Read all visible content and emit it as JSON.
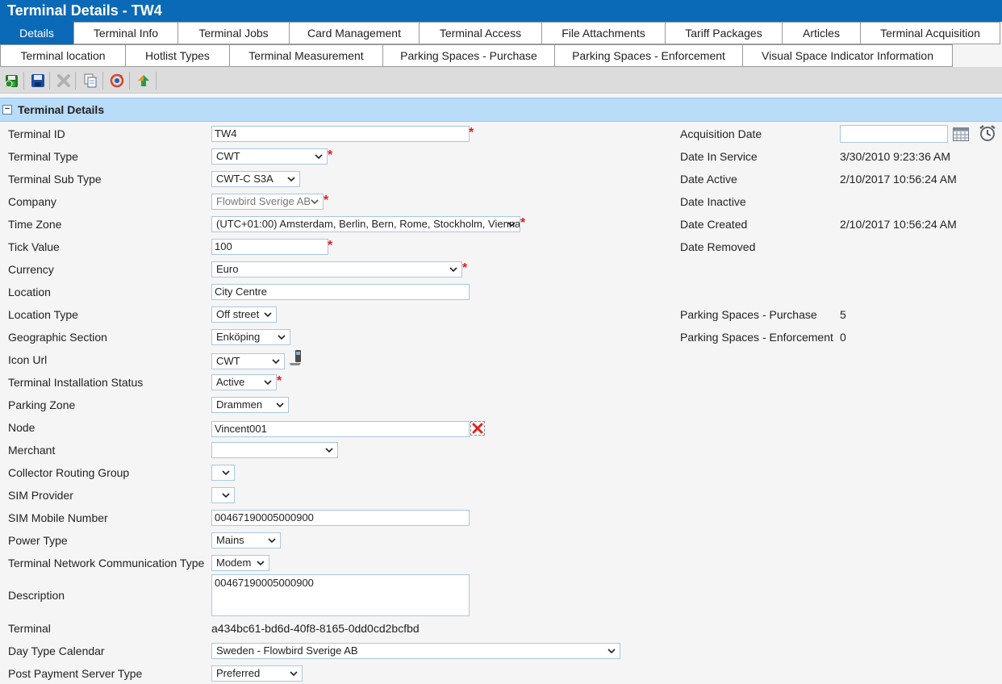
{
  "window": {
    "title": "Terminal Details - TW4"
  },
  "tabs_row1": [
    {
      "label": "Details"
    },
    {
      "label": "Terminal Info"
    },
    {
      "label": "Terminal Jobs"
    },
    {
      "label": "Card Management"
    },
    {
      "label": "Terminal Access"
    },
    {
      "label": "File Attachments"
    },
    {
      "label": "Tariff Packages"
    },
    {
      "label": "Articles"
    },
    {
      "label": "Terminal Acquisition"
    }
  ],
  "tabs_row2": [
    {
      "label": "Terminal location"
    },
    {
      "label": "Hotlist Types"
    },
    {
      "label": "Terminal Measurement"
    },
    {
      "label": "Parking Spaces - Purchase"
    },
    {
      "label": "Parking Spaces - Enforcement"
    },
    {
      "label": "Visual Space Indicator Information"
    }
  ],
  "toolbar": {
    "icons": [
      "save-and-close-icon",
      "save-icon",
      "delete-icon",
      "copy-icon",
      "refresh-settings-icon",
      "upload-icon"
    ]
  },
  "section": {
    "title": "Terminal Details",
    "collapse_symbol": "−"
  },
  "fields": {
    "terminal_id": {
      "label": "Terminal ID",
      "value": "TW4"
    },
    "terminal_type": {
      "label": "Terminal Type",
      "value": "CWT"
    },
    "terminal_sub_type": {
      "label": "Terminal Sub Type",
      "value": "CWT-C S3A"
    },
    "company": {
      "label": "Company",
      "value": "Flowbird Sverige AB"
    },
    "time_zone": {
      "label": "Time Zone",
      "value": "(UTC+01:00) Amsterdam, Berlin, Bern, Rome, Stockholm, Vienna"
    },
    "tick_value": {
      "label": "Tick Value",
      "value": "100"
    },
    "currency": {
      "label": "Currency",
      "value": "Euro"
    },
    "location": {
      "label": "Location",
      "value": "City Centre"
    },
    "location_type": {
      "label": "Location Type",
      "value": "Off street"
    },
    "geographic_section": {
      "label": "Geographic Section",
      "value": "Enköping"
    },
    "icon_url": {
      "label": "Icon Url",
      "value": "CWT"
    },
    "installation_status": {
      "label": "Terminal Installation Status",
      "value": "Active"
    },
    "parking_zone": {
      "label": "Parking Zone",
      "value": "Drammen"
    },
    "node": {
      "label": "Node",
      "value": "Vincent001"
    },
    "merchant": {
      "label": "Merchant",
      "value": ""
    },
    "collector_routing_group": {
      "label": "Collector Routing Group",
      "value": ""
    },
    "sim_provider": {
      "label": "SIM Provider",
      "value": ""
    },
    "sim_mobile_number": {
      "label": "SIM Mobile Number",
      "value": "00467190005000900"
    },
    "power_type": {
      "label": "Power Type",
      "value": "Mains"
    },
    "network_comm_type": {
      "label": "Terminal Network Communication Type",
      "value": "Modem"
    },
    "description": {
      "label": "Description",
      "value": "00467190005000900"
    },
    "terminal": {
      "label": "Terminal",
      "value": "a434bc61-bd6d-40f8-8165-0dd0cd2bcfbd"
    },
    "day_type_calendar": {
      "label": "Day Type Calendar",
      "value": "Sweden - Flowbird Sverige AB"
    },
    "post_payment_server_type": {
      "label": "Post Payment Server Type",
      "value": "Preferred"
    }
  },
  "right": {
    "acquisition_date": {
      "label": "Acquisition Date",
      "value": ""
    },
    "date_in_service": {
      "label": "Date In Service",
      "value": "3/30/2010 9:23:36 AM"
    },
    "date_active": {
      "label": "Date Active",
      "value": "2/10/2017 10:56:24 AM"
    },
    "date_inactive": {
      "label": "Date Inactive",
      "value": ""
    },
    "date_created": {
      "label": "Date Created",
      "value": "2/10/2017 10:56:24 AM"
    },
    "date_removed": {
      "label": "Date Removed",
      "value": ""
    },
    "parking_spaces_purchase": {
      "label": "Parking Spaces - Purchase",
      "value": "5"
    },
    "parking_spaces_enforcement": {
      "label": "Parking Spaces - Enforcement",
      "value": "0"
    }
  },
  "required_mark": "*",
  "colors": {
    "header_blue": "#0a6ab8",
    "section_blue": "#b9dcf8",
    "required_red": "#e21b1b"
  }
}
